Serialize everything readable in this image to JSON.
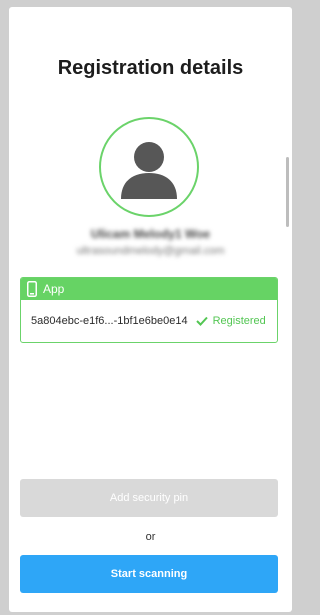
{
  "page": {
    "title": "Registration details"
  },
  "user": {
    "name": "Ulicam Melody1 Woe",
    "email": "ultrasoundmelody@gmail.com"
  },
  "device": {
    "type_label": "App",
    "id": "5a804ebc-e1f6...-1bf1e6be0e14",
    "status": "Registered",
    "status_color": "#53c653",
    "accent_color": "#66d364",
    "icon": "phone-icon"
  },
  "actions": {
    "add_pin_label": "Add security pin",
    "separator": "or",
    "start_scanning_label": "Start scanning",
    "primary_color": "#2ea6f7",
    "disabled_color": "#d9d9d9"
  }
}
